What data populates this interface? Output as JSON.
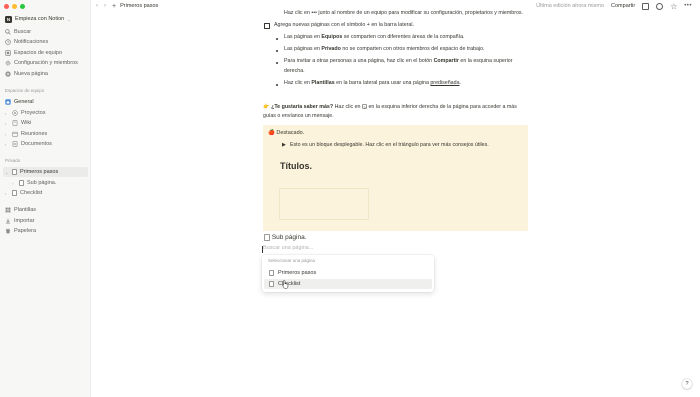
{
  "sidebar": {
    "workspace": "Empieza con Notion",
    "workspace_badge": "N",
    "top_items": [
      {
        "label": "Buscar",
        "icon": "search-icon"
      },
      {
        "label": "Notificaciones",
        "icon": "clock-icon"
      },
      {
        "label": "Espacios de equipo",
        "icon": "teamspace-icon"
      },
      {
        "label": "Configuración y miembros",
        "icon": "gear-icon"
      },
      {
        "label": "Nueva página",
        "icon": "plus-circle-icon"
      }
    ],
    "teamspaces_title": "Espacios de equipo",
    "teamspace_general": "General",
    "teamspace_pages": [
      "Proyectos",
      "Wiki",
      "Reuniones",
      "Documentos"
    ],
    "private_title": "Privado",
    "private_pages": [
      "Primeros pasos",
      "Sub página.",
      "Checklist"
    ],
    "bottom_items": [
      {
        "label": "Plantillas",
        "icon": "templates-icon"
      },
      {
        "label": "Importar",
        "icon": "import-icon"
      },
      {
        "label": "Papelera",
        "icon": "trash-icon"
      }
    ]
  },
  "topbar": {
    "breadcrumb": "Primeros pasos",
    "edited": "Última edición ahora mismo",
    "share": "Compartir",
    "more": "•••"
  },
  "content": {
    "line1": "Haz clic en ••• junto al nombre de un equipo para modificar su configuración, propietarios y miembros.",
    "line2": "Agrega nuevas páginas con el símbolo + en la barra lateral.",
    "b1_pre": "Las páginas en ",
    "b1_bold": "Equipos",
    "b1_post": " se comparten con diferentes áreas de la compañía.",
    "b2_pre": "Las páginas en ",
    "b2_bold": "Privado",
    "b2_post": " no se comparten con otros miembros del espacio de trabajo.",
    "b3_pre": "Para invitar a otras personas a una página, haz clic en el botón ",
    "b3_bold": "Compartir",
    "b3_post": " en la esquina superior",
    "b3_cont": "derecha.",
    "b4_pre": "Haz clic en ",
    "b4_bold": "Plantillas",
    "b4_mid": " en la barra lateral para usar una página ",
    "b4_link": "prediseñada",
    "b4_end": ".",
    "help_emoji": "👉",
    "help_bold": "¿Te gustaría saber más?",
    "help_pre": " Haz clic en ",
    "help_q": "?",
    "help_post": " en la esquina inferior derecha de la página para acceder a más",
    "help_cont": "guías o envíanos un mensaje.",
    "callout_icon": "🍎",
    "callout_title": "Destacado.",
    "toggle_text": "Esto es un bloque desplegable. Haz clic en el triángulo para ver más consejos útiles.",
    "heading": "Títulos.",
    "subpage_link": "Sub página.",
    "search_placeholder": "Buscar una página..."
  },
  "dropdown": {
    "title": "Seleccionar una página",
    "items": [
      "Primeros pasos",
      "Checklist"
    ]
  },
  "help_button": "?"
}
